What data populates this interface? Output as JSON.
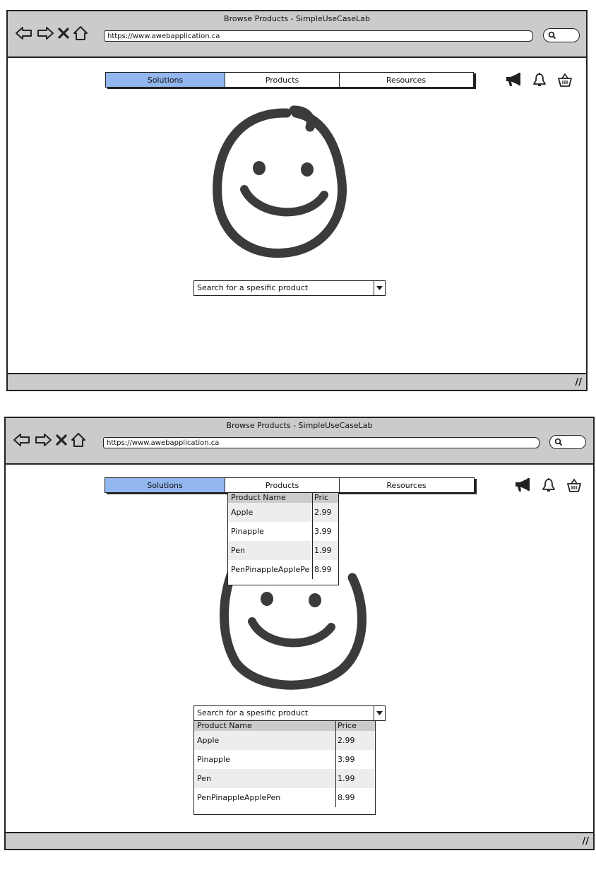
{
  "browser": {
    "title": "Browse Products - SimpleUseCaseLab",
    "url": "https://www.awebapplication.ca"
  },
  "nav": {
    "tabs": [
      "Solutions",
      "Products",
      "Resources"
    ],
    "active_tab": "Solutions"
  },
  "search": {
    "placeholder": "Search for a spesific product"
  },
  "products_dropdown": {
    "headers": [
      "Product Name",
      "Pric"
    ],
    "rows": [
      {
        "name": "Apple",
        "price": "2.99"
      },
      {
        "name": "Pinapple",
        "price": "3.99"
      },
      {
        "name": "Pen",
        "price": "1.99"
      },
      {
        "name": "PenPinappleApplePe",
        "price": "8.99"
      }
    ]
  },
  "search_results": {
    "headers": [
      "Product Name",
      "Price"
    ],
    "rows": [
      {
        "name": "Apple",
        "price": "2.99"
      },
      {
        "name": "Pinapple",
        "price": "3.99"
      },
      {
        "name": "Pen",
        "price": "1.99"
      },
      {
        "name": "PenPinappleApplePen",
        "price": "8.99"
      }
    ]
  },
  "icons": {
    "toolbar": [
      "back-arrow-icon",
      "forward-arrow-icon",
      "close-icon",
      "home-icon",
      "search-icon"
    ],
    "header": [
      "megaphone-icon",
      "bell-icon",
      "basket-icon"
    ],
    "logo": "smiley-face-icon"
  },
  "colors": {
    "active_tab": "#92b6ee",
    "chrome": "#cbcbcb"
  }
}
